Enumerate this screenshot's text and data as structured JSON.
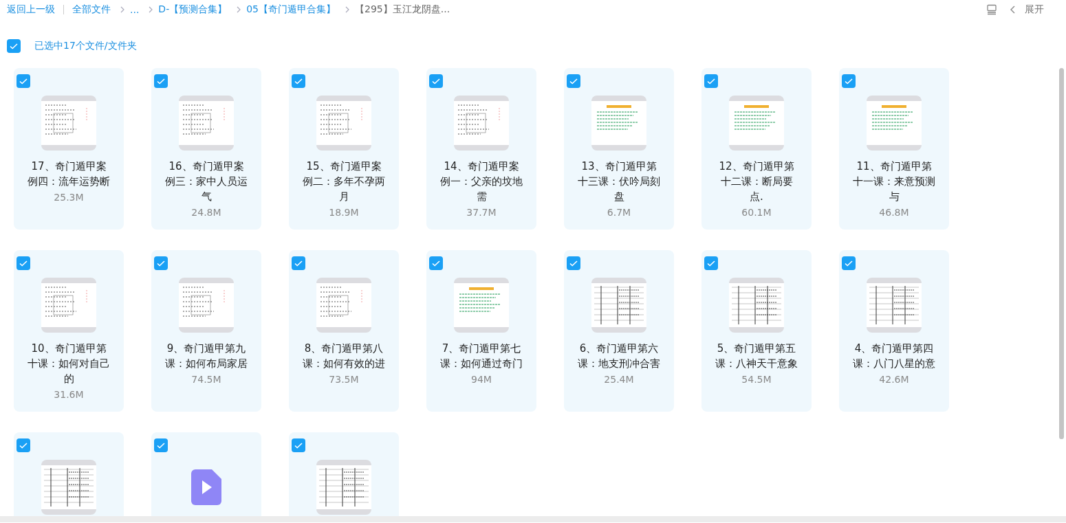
{
  "breadcrumb": {
    "back": "返回上一级",
    "items": [
      {
        "label": "全部文件",
        "current": false
      },
      {
        "label": "...",
        "current": false
      },
      {
        "label": "D-【预测合集】",
        "current": false
      },
      {
        "label": "05【奇门遁甲合集】",
        "current": false
      },
      {
        "label": "【295】玉江龙阴盘...",
        "current": true
      }
    ]
  },
  "toolbar": {
    "expand": "展开"
  },
  "selection": {
    "checked": true,
    "label": "已选中17个文件/文件夹"
  },
  "files": [
    {
      "name": "17、奇门遁甲案例四：流年运势断",
      "size": "25.3M",
      "selected": true,
      "kind": "scan"
    },
    {
      "name": "16、奇门遁甲案例三：家中人员运气",
      "size": "24.8M",
      "selected": true,
      "kind": "scan"
    },
    {
      "name": "15、奇门遁甲案例二：多年不孕两月",
      "size": "18.9M",
      "selected": true,
      "kind": "scan"
    },
    {
      "name": "14、奇门遁甲案例一：父亲的坟地需",
      "size": "37.7M",
      "selected": true,
      "kind": "scan"
    },
    {
      "name": "13、奇门遁甲第十三课：伏吟局刻盘",
      "size": "6.7M",
      "selected": true,
      "kind": "slide"
    },
    {
      "name": "12、奇门遁甲第十二课：断局要点.",
      "size": "60.1M",
      "selected": true,
      "kind": "slide"
    },
    {
      "name": "11、奇门遁甲第十一课：来意预测与",
      "size": "46.8M",
      "selected": true,
      "kind": "slide"
    },
    {
      "name": "10、奇门遁甲第十课：如何对自己的",
      "size": "31.6M",
      "selected": true,
      "kind": "scan"
    },
    {
      "name": "9、奇门遁甲第九课：如何布局家居",
      "size": "74.5M",
      "selected": true,
      "kind": "scan"
    },
    {
      "name": "8、奇门遁甲第八课：如何有效的进",
      "size": "73.5M",
      "selected": true,
      "kind": "scan"
    },
    {
      "name": "7、奇门遁甲第七课：如何通过奇门",
      "size": "94M",
      "selected": true,
      "kind": "slide"
    },
    {
      "name": "6、奇门遁甲第六课：地支刑冲合害",
      "size": "25.4M",
      "selected": true,
      "kind": "table"
    },
    {
      "name": "5、奇门遁甲第五课：八神天干意象",
      "size": "54.5M",
      "selected": true,
      "kind": "table"
    },
    {
      "name": "4、奇门遁甲第四课：八门八星的意",
      "size": "42.6M",
      "selected": true,
      "kind": "table"
    },
    {
      "selected": true,
      "kind": "table"
    },
    {
      "selected": true,
      "kind": "video"
    },
    {
      "selected": true,
      "kind": "table"
    }
  ]
}
